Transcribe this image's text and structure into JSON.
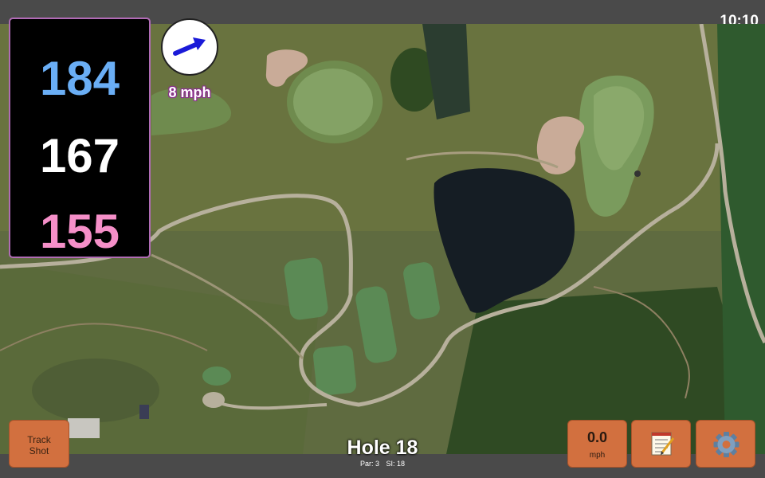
{
  "status_bar": {
    "time": "10:10"
  },
  "distances": {
    "back": "184",
    "middle": "167",
    "front": "155"
  },
  "wind": {
    "speed_label": "8 mph",
    "direction_icon": "wind-arrow-icon"
  },
  "hole": {
    "title": "Hole 18",
    "par_label": "Par: 3",
    "si_label": "SI: 18"
  },
  "buttons": {
    "track_shot_line1": "Track",
    "track_shot_line2": "Shot",
    "speed_value": "0.0",
    "speed_unit": "mph",
    "notes_icon": "notepad-icon",
    "settings_icon": "gear-icon"
  },
  "colors": {
    "back_distance": "#6aaef5",
    "middle_distance": "#ffffff",
    "front_distance": "#f58fc8",
    "button_orange": "#d2703f",
    "panel_border": "#b06bb5"
  }
}
